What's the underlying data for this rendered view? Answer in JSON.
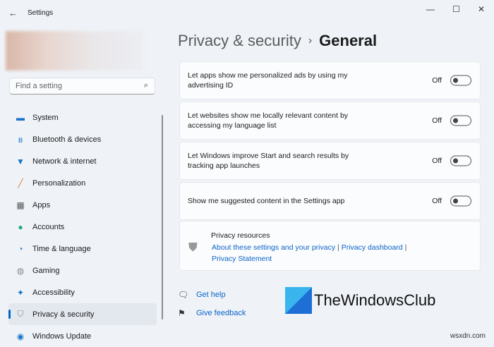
{
  "window": {
    "title": "Settings",
    "minimize": "—",
    "maximize": "☐",
    "close": "✕"
  },
  "search": {
    "placeholder": "Find a setting"
  },
  "nav": [
    {
      "label": "System",
      "icon": "▬",
      "color": "#1a73c8"
    },
    {
      "label": "Bluetooth & devices",
      "icon": "ʙ",
      "color": "#1a73c8"
    },
    {
      "label": "Network & internet",
      "icon": "▼",
      "color": "#1a73c8"
    },
    {
      "label": "Personalization",
      "icon": "╱",
      "color": "#e07a2f"
    },
    {
      "label": "Apps",
      "icon": "▦",
      "color": "#555"
    },
    {
      "label": "Accounts",
      "icon": "●",
      "color": "#2aa58a"
    },
    {
      "label": "Time & language",
      "icon": "◔",
      "color": "#1a73c8"
    },
    {
      "label": "Gaming",
      "icon": "◍",
      "color": "#888"
    },
    {
      "label": "Accessibility",
      "icon": "✦",
      "color": "#1a73c8"
    },
    {
      "label": "Privacy & security",
      "icon": "⛉",
      "color": "#888"
    },
    {
      "label": "Windows Update",
      "icon": "◉",
      "color": "#1a73c8"
    }
  ],
  "breadcrumb": {
    "parent": "Privacy & security",
    "sep": "›",
    "current": "General"
  },
  "settings": [
    {
      "label": "Let apps show me personalized ads by using my advertising ID",
      "state": "Off"
    },
    {
      "label": "Let websites show me locally relevant content by accessing my language list",
      "state": "Off"
    },
    {
      "label": "Let Windows improve Start and search results by tracking app launches",
      "state": "Off"
    },
    {
      "label": "Show me suggested content in the Settings app",
      "state": "Off"
    }
  ],
  "resources": {
    "title": "Privacy resources",
    "link1": "About these settings and your privacy",
    "link2": "Privacy dashboard",
    "link3": "Privacy Statement",
    "sep": "|"
  },
  "help": {
    "get_help": "Get help",
    "feedback": "Give feedback"
  },
  "logo": "TheWindowsClub",
  "watermark": "wsxdn.com"
}
